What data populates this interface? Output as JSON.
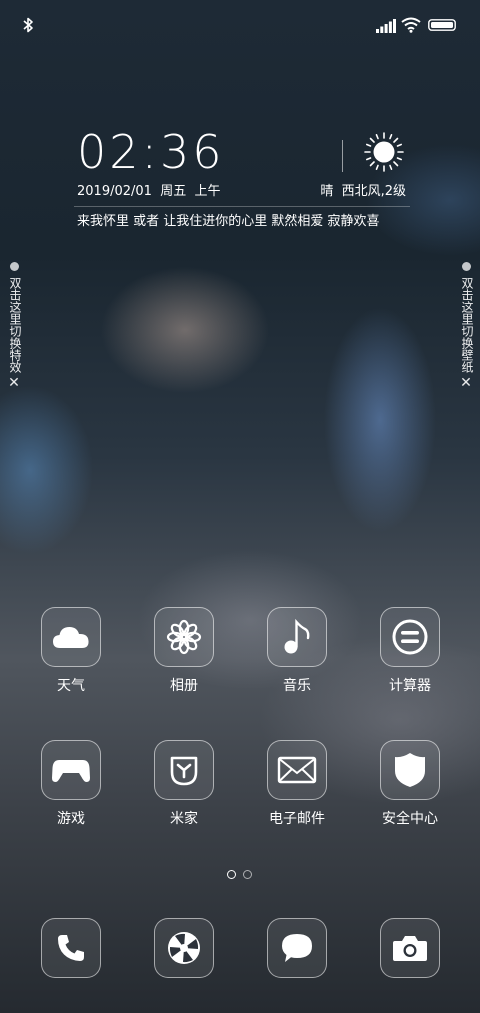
{
  "status_bar": {
    "icons": [
      "bluetooth-icon",
      "signal-icon",
      "wifi-icon",
      "battery-icon"
    ]
  },
  "clock_widget": {
    "time": "02:36",
    "date": "2019/02/01  周五  上午",
    "weather": "晴  西北风,2级",
    "weather_icon": "sun-icon",
    "quote": "来我怀里 或者 让我住进你的心里 默然相爱 寂静欢喜"
  },
  "side_hints": {
    "left": {
      "text": "双击这里切换特效",
      "close": "✕"
    },
    "right": {
      "text": "双击这里切换壁纸",
      "close": "✕"
    }
  },
  "apps": [
    {
      "label": "天气",
      "icon": "cloud-icon"
    },
    {
      "label": "相册",
      "icon": "flower-icon"
    },
    {
      "label": "音乐",
      "icon": "music-note-icon"
    },
    {
      "label": "计算器",
      "icon": "calculator-icon"
    },
    {
      "label": "游戏",
      "icon": "gamepad-icon"
    },
    {
      "label": "米家",
      "icon": "mijia-icon"
    },
    {
      "label": "电子邮件",
      "icon": "mail-icon"
    },
    {
      "label": "安全中心",
      "icon": "shield-icon"
    }
  ],
  "page_indicator": {
    "current": 1,
    "total": 2
  },
  "dock": [
    {
      "icon": "phone-icon"
    },
    {
      "icon": "browser-icon"
    },
    {
      "icon": "message-icon"
    },
    {
      "icon": "camera-icon"
    }
  ],
  "colors": {
    "icon_stroke": "#ffffff",
    "text": "#ffffff"
  }
}
